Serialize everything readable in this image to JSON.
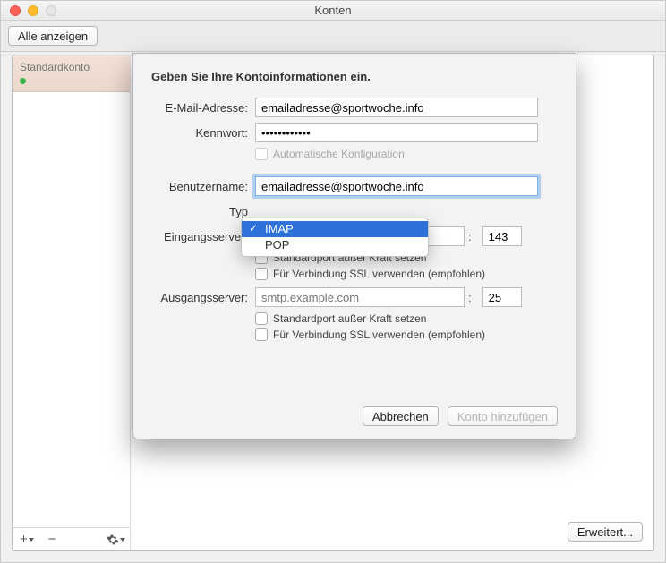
{
  "window": {
    "title": "Konten",
    "toolbar_show_all": "Alle anzeigen"
  },
  "sidebar": {
    "default_account": "Standardkonto",
    "add": "+",
    "remove": "−",
    "gear": "gear"
  },
  "right": {
    "advanced_button": "Erweitert..."
  },
  "sheet": {
    "heading": "Geben Sie Ihre Kontoinformationen ein.",
    "labels": {
      "email": "E-Mail-Adresse:",
      "password": "Kennwort:",
      "username": "Benutzername:",
      "type": "Typ",
      "incoming": "Eingangsserver:",
      "outgoing": "Ausgangsserver:"
    },
    "values": {
      "email": "emailadresse@sportwoche.info",
      "password": "••••••••••••",
      "username": "emailadresse@sportwoche.info",
      "incoming_server": "",
      "incoming_port": "143",
      "outgoing_server": "",
      "outgoing_port": "25",
      "outgoing_placeholder": "smtp.example.com"
    },
    "checkboxes": {
      "auto_config": "Automatische Konfiguration",
      "override_port": "Standardport außer Kraft setzen",
      "use_ssl": "Für Verbindung SSL verwenden (empfohlen)"
    },
    "buttons": {
      "cancel": "Abbrechen",
      "add": "Konto hinzufügen"
    },
    "type_options": {
      "imap": "IMAP",
      "pop": "POP"
    }
  }
}
